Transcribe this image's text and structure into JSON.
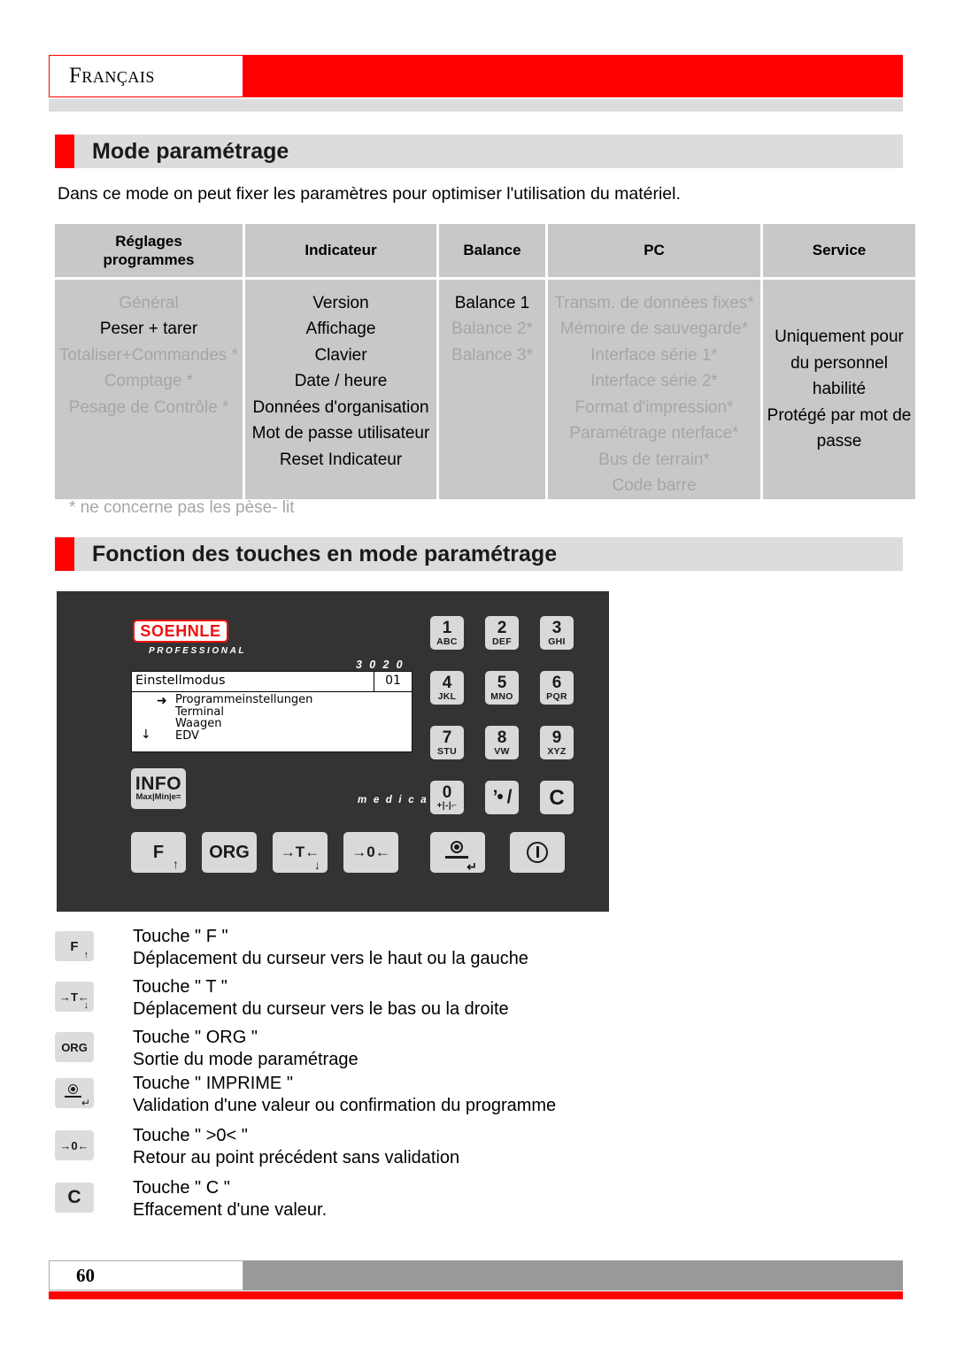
{
  "header": {
    "language_label": "Français"
  },
  "sections": {
    "mode_heading": "Mode paramétrage",
    "fonction_heading": "Fonction des touches en mode paramétrage"
  },
  "intro": {
    "text": "Dans ce mode on peut fixer les paramètres pour optimiser l'utilisation du matériel."
  },
  "table": {
    "headers": [
      "Réglages\nprogrammes",
      "Indicateur",
      "Balance",
      "PC",
      "Service"
    ],
    "header_line1": "Réglages",
    "header_line2": "programmes",
    "columns": {
      "reglages": [
        {
          "label": "Général",
          "enabled": false
        },
        {
          "label": "Peser + tarer",
          "enabled": true
        },
        {
          "label": "Totaliser+Commandes *",
          "enabled": false
        },
        {
          "label": "Comptage *",
          "enabled": false
        },
        {
          "label": "Pesage de Contrôle *",
          "enabled": false
        }
      ],
      "indicateur": [
        {
          "label": "Version",
          "enabled": true
        },
        {
          "label": "Affichage",
          "enabled": true
        },
        {
          "label": "Clavier",
          "enabled": true
        },
        {
          "label": "Date / heure",
          "enabled": true
        },
        {
          "label": "Données d'organisation",
          "enabled": true
        },
        {
          "label": "Mot de passe utilisateur",
          "enabled": true
        },
        {
          "label": "Reset Indicateur",
          "enabled": true
        }
      ],
      "balance": [
        {
          "label": "Balance 1",
          "enabled": true
        },
        {
          "label": "Balance 2*",
          "enabled": false
        },
        {
          "label": "Balance 3*",
          "enabled": false
        }
      ],
      "pc": [
        {
          "label": "Transm. de données fixes*",
          "enabled": false
        },
        {
          "label": "Mémoire de sauvegarde*",
          "enabled": false
        },
        {
          "label": "Interface série 1*",
          "enabled": false
        },
        {
          "label": "Interface série 2*",
          "enabled": false
        },
        {
          "label": "Format d'impression*",
          "enabled": false
        },
        {
          "label": "Paramétrage nterface*",
          "enabled": false
        },
        {
          "label": "Bus de terrain*",
          "enabled": false
        },
        {
          "label": "Code barre",
          "enabled": false
        }
      ],
      "service": [
        "Uniquement pour",
        "du  personnel",
        "habilité",
        "Protégé par mot de",
        "passe"
      ]
    }
  },
  "footnote": "* ne concerne pas les pèse- lit",
  "device": {
    "brand": "SOEHNLE",
    "brand_sub": "PROFESSIONAL",
    "model": "3 0 2 0",
    "market": "m e d i c a l",
    "lcd": {
      "title": "Einstellmodus",
      "number": "01",
      "cursor": "➜",
      "scroll_down": "↓",
      "menu": [
        "Programmeinstellungen",
        "Terminal",
        "Waagen",
        "EDV"
      ]
    },
    "numeric_keys": [
      {
        "digit": "1",
        "letters": "ABC"
      },
      {
        "digit": "2",
        "letters": "DEF"
      },
      {
        "digit": "3",
        "letters": "GHI"
      },
      {
        "digit": "4",
        "letters": "JKL"
      },
      {
        "digit": "5",
        "letters": "MNO"
      },
      {
        "digit": "6",
        "letters": "PQR"
      },
      {
        "digit": "7",
        "letters": "STU"
      },
      {
        "digit": "8",
        "letters": "VW"
      },
      {
        "digit": "9",
        "letters": "XYZ"
      }
    ],
    "zero_key": {
      "digit": "0",
      "sub": "+|-|⌐"
    },
    "comma_key": "’• /",
    "clear_key": "C",
    "info_key": {
      "label": "INFO",
      "sub": "Max|Min|e="
    },
    "function_keys": [
      {
        "label": "F",
        "corner": "↑"
      },
      {
        "label": "ORG",
        "corner": ""
      },
      {
        "label": "→T←",
        "corner": "↓"
      },
      {
        "label": "→0←",
        "corner": ""
      }
    ],
    "print_key_enter": "↵"
  },
  "legend": [
    {
      "key_label": "F",
      "key_corner": "↑",
      "title": "Touche \" F \"",
      "description": "Déplacement du curseur vers le haut ou la gauche"
    },
    {
      "key_label": "→T←",
      "key_corner": "↓",
      "title": "Touche \" T \"",
      "description": "Déplacement du curseur vers le bas ou la droite"
    },
    {
      "key_label": "ORG",
      "key_corner": "",
      "title": "Touche \" ORG \"",
      "description": "Sortie du mode paramétrage"
    },
    {
      "key_label": "",
      "key_corner": "",
      "title": "Touche \" IMPRIME \"",
      "description": "Validation d'une valeur ou confirmation du programme"
    },
    {
      "key_label": "→0←",
      "key_corner": "",
      "title": "Touche \" >0< \"",
      "description": "Retour au point précédent sans validation"
    },
    {
      "key_label": "C",
      "key_corner": "",
      "title": "Touche \" C \"",
      "description": "Effacement d'une valeur."
    }
  ],
  "footer": {
    "page_number": "60"
  },
  "colors": {
    "accent_red": "#ff0000",
    "band_grey": "#dcdcdc",
    "table_cell_grey": "#c8c8c8",
    "disabled_text": "#a6a6a6",
    "device_body": "#333333",
    "key_grey": "#d9d9d9",
    "footer_grey": "#999999"
  }
}
